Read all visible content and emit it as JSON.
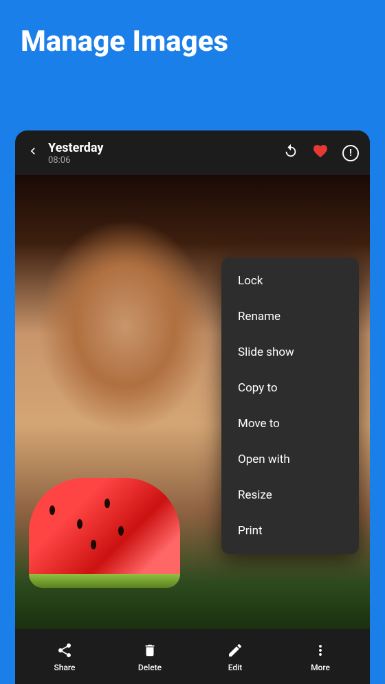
{
  "header": {
    "title": "Manage Images"
  },
  "topBar": {
    "back_icon": "back-chevron",
    "title": "Yesterday",
    "subtitle": "08:06",
    "rotate_icon": "rotate-icon",
    "heart_icon": "heart-icon",
    "info_icon": "info-icon"
  },
  "menu": {
    "items": [
      {
        "id": "lock",
        "label": "Lock"
      },
      {
        "id": "rename",
        "label": "Rename"
      },
      {
        "id": "slideshow",
        "label": "Slide show"
      },
      {
        "id": "copy-to",
        "label": "Copy to"
      },
      {
        "id": "move-to",
        "label": "Move to"
      },
      {
        "id": "open-with",
        "label": "Open with"
      },
      {
        "id": "resize",
        "label": "Resize"
      },
      {
        "id": "print",
        "label": "Print"
      }
    ]
  },
  "bottomBar": {
    "items": [
      {
        "id": "share",
        "label": "Share",
        "icon": "share-icon"
      },
      {
        "id": "delete",
        "label": "Delete",
        "icon": "delete-icon"
      },
      {
        "id": "edit",
        "label": "Edit",
        "icon": "edit-icon"
      },
      {
        "id": "more",
        "label": "More",
        "icon": "more-icon"
      }
    ]
  }
}
